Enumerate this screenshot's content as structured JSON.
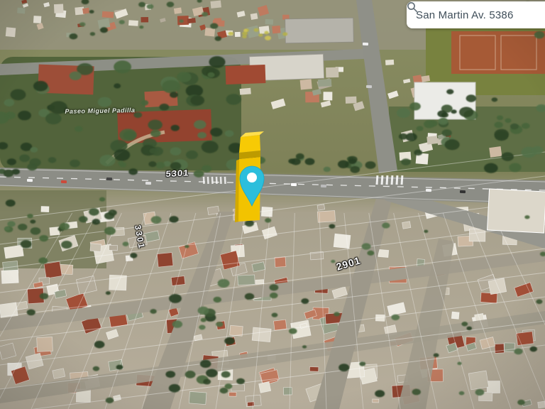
{
  "search": {
    "value": "San Martin Av. 5386",
    "icon": "search-icon"
  },
  "map_labels": {
    "avenue_block_number": "5301",
    "cross_street_block_number": "2901",
    "side_street_block_number": "3301",
    "park_name": "Paseo Miguel Padilla"
  },
  "marker": {
    "icon": "map-pin-icon",
    "pin_color": "#2CBEDC",
    "building_highlight_color": "#F2C300"
  }
}
